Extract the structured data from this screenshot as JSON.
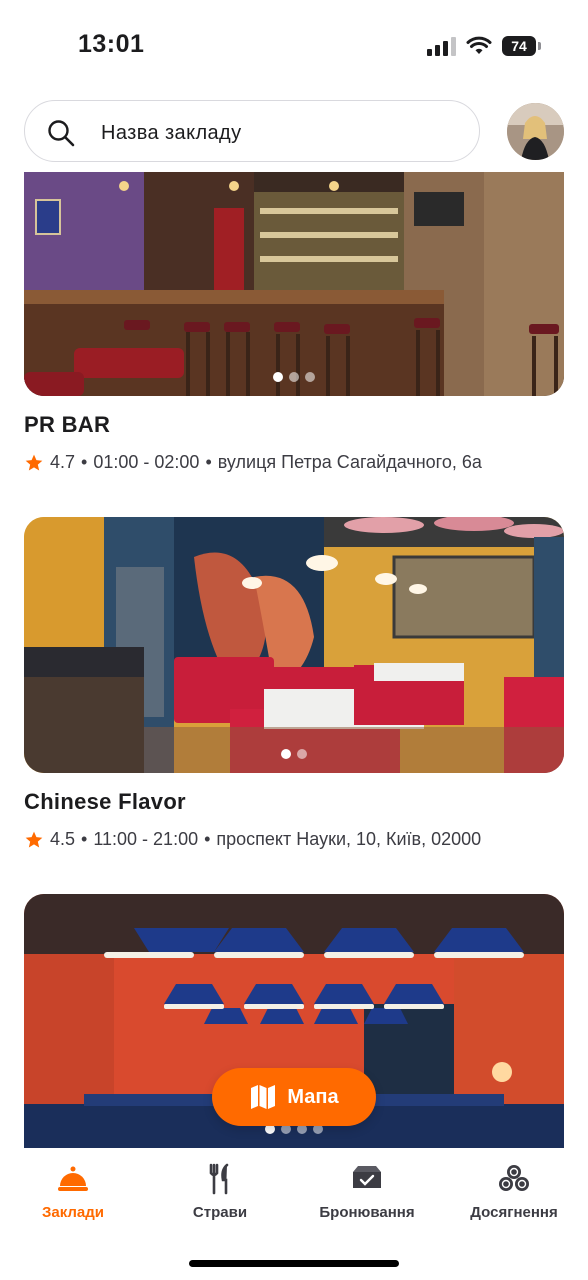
{
  "status_bar": {
    "time": "13:01",
    "battery": "74"
  },
  "search": {
    "placeholder": "Назва закладу"
  },
  "venues": [
    {
      "name": "PR BAR",
      "rating": "4.7",
      "hours": "01:00 - 02:00",
      "address": "вулиця Петра Сагайдачного, 6а",
      "photo_count": 3,
      "active_photo": 1
    },
    {
      "name": "Chinese Flavor",
      "rating": "4.5",
      "hours": "11:00 - 21:00",
      "address": "проспект Науки, 10, Київ, 02000",
      "photo_count": 2,
      "active_photo": 1
    },
    {
      "photo_count": 4,
      "active_photo": 1
    }
  ],
  "map_button": {
    "label": "Мапа"
  },
  "tabs": [
    {
      "label": "Заклади",
      "icon": "cloche-icon",
      "active": true
    },
    {
      "label": "Страви",
      "icon": "fork-knife-icon",
      "active": false
    },
    {
      "label": "Бронювання",
      "icon": "reserved-sign-icon",
      "active": false
    },
    {
      "label": "Досягнення",
      "icon": "coins-stack-icon",
      "active": false
    }
  ],
  "colors": {
    "accent": "#ff6a00",
    "star": "#ff6a00",
    "text": "#1c1c1e"
  }
}
